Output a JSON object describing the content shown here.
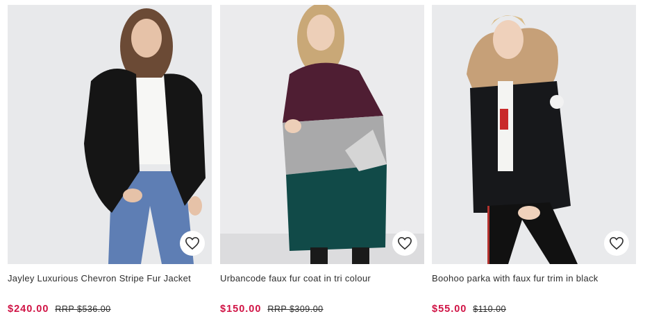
{
  "products": [
    {
      "title": "Jayley Luxurious Chevron Stripe Fur Jacket",
      "price": "$240.00",
      "rrp": "RRP $536.00",
      "wishlist_icon": "heart-outline-icon"
    },
    {
      "title": "Urbancode faux fur coat in tri colour",
      "price": "$150.00",
      "rrp": "RRP $309.00",
      "wishlist_icon": "heart-outline-icon"
    },
    {
      "title": "Boohoo parka with faux fur trim in black",
      "price": "$55.00",
      "rrp": "$110.00",
      "wishlist_icon": "heart-outline-icon"
    }
  ],
  "colors": {
    "price": "#d01345",
    "text": "#2d2d2d",
    "photo_background": "#e9eaec"
  }
}
